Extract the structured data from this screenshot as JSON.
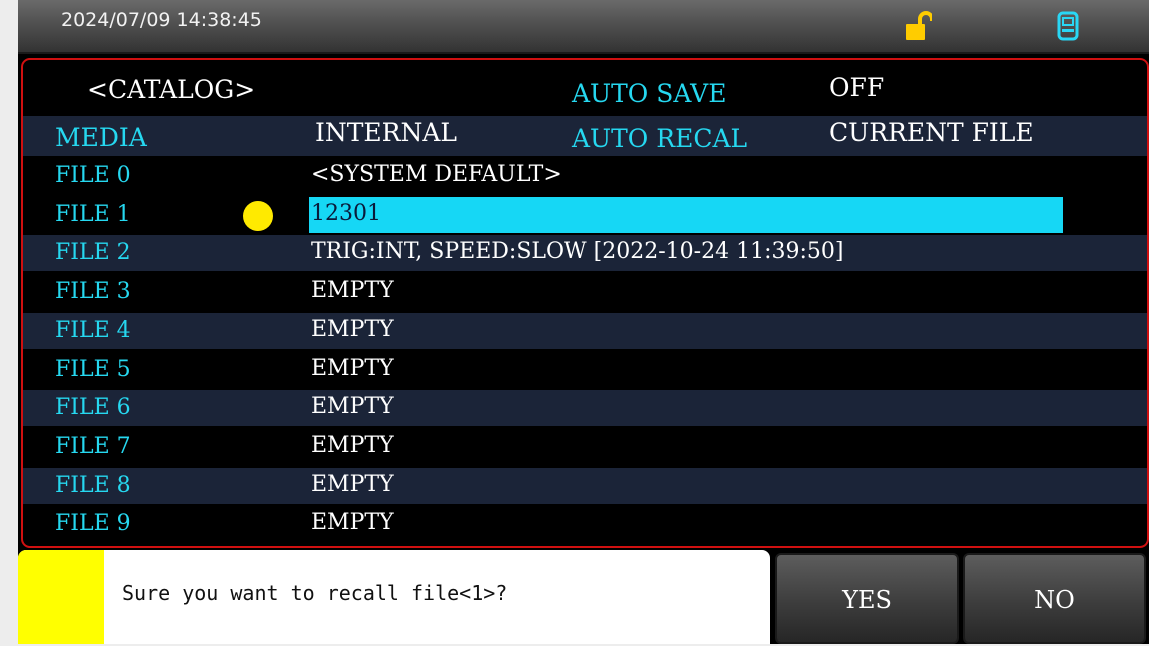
{
  "status_bar": {
    "datetime": "2024/07/09 14:38:45",
    "lock_icon": "unlocked-padlock-icon",
    "usb_icon": "usb-drive-icon",
    "lock_color": "#ffcc00",
    "usb_color": "#29d7f5"
  },
  "catalog": {
    "title": "<CATALOG>",
    "auto_save_label": "AUTO SAVE",
    "auto_save_value": "OFF",
    "media_label": "MEDIA",
    "media_value": "INTERNAL",
    "auto_recal_label": "AUTO RECAL",
    "auto_recal_value": "CURRENT FILE"
  },
  "files": [
    {
      "label": "FILE 0",
      "content": "<SYSTEM DEFAULT>"
    },
    {
      "label": "FILE 1",
      "content": "12301",
      "selected": true,
      "current": true
    },
    {
      "label": "FILE 2",
      "content": "TRIG:INT, SPEED:SLOW [2022-10-24 11:39:50]"
    },
    {
      "label": "FILE 3",
      "content": "EMPTY"
    },
    {
      "label": "FILE 4",
      "content": "EMPTY"
    },
    {
      "label": "FILE 5",
      "content": "EMPTY"
    },
    {
      "label": "FILE 6",
      "content": "EMPTY"
    },
    {
      "label": "FILE 7",
      "content": "EMPTY"
    },
    {
      "label": "FILE 8",
      "content": "EMPTY"
    },
    {
      "label": "FILE 9",
      "content": "EMPTY"
    }
  ],
  "dialog": {
    "message": "Sure you want to recall file<1>?",
    "yes_label": "YES",
    "no_label": "NO"
  },
  "colors": {
    "label_cyan": "#26d8f0",
    "selection": "#16d7f5",
    "panel_border": "#d01010",
    "dot": "#ffea00",
    "dialog_marker": "#ffff00"
  }
}
